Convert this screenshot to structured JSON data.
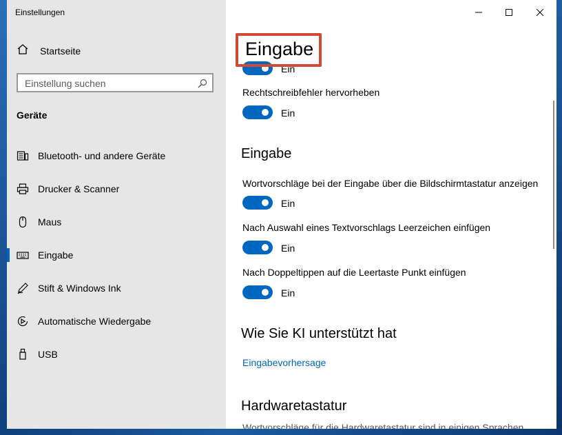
{
  "window": {
    "title": "Einstellungen"
  },
  "sidebar": {
    "home_label": "Startseite",
    "search_placeholder": "Einstellung suchen",
    "section_label": "Geräte",
    "items": [
      {
        "label": "Bluetooth- und andere Geräte",
        "icon": "bluetooth-devices-icon"
      },
      {
        "label": "Drucker & Scanner",
        "icon": "printer-icon"
      },
      {
        "label": "Maus",
        "icon": "mouse-icon"
      },
      {
        "label": "Eingabe",
        "icon": "keyboard-icon",
        "active": true
      },
      {
        "label": "Stift & Windows Ink",
        "icon": "pen-icon"
      },
      {
        "label": "Automatische Wiedergabe",
        "icon": "autoplay-icon"
      },
      {
        "label": "USB",
        "icon": "usb-icon"
      }
    ]
  },
  "content": {
    "page_title": "Eingabe",
    "partial_toggle_state": "Ein",
    "spelling": {
      "highlight_label": "Rechtschreibfehler hervorheben",
      "highlight_state": "Ein"
    },
    "typing_section": {
      "title": "Eingabe",
      "settings": [
        {
          "label": "Wortvorschläge bei der Eingabe über die Bildschirmtastatur anzeigen",
          "state": "Ein"
        },
        {
          "label": "Nach Auswahl eines Textvorschlags Leerzeichen einfügen",
          "state": "Ein"
        },
        {
          "label": "Nach Doppeltippen auf die Leertaste Punkt einfügen",
          "state": "Ein"
        }
      ]
    },
    "ai_section": {
      "title": "Wie Sie KI unterstützt hat",
      "link": "Eingabevorhersage"
    },
    "hardware_section": {
      "title": "Hardwaretastatur",
      "description": "Wortvorschläge für die Hardwaretastatur sind in einigen Sprachen"
    }
  },
  "colors": {
    "accent": "#0067c0",
    "highlight_border": "#d04a36",
    "sidebar_bg": "#e6e6e6"
  }
}
